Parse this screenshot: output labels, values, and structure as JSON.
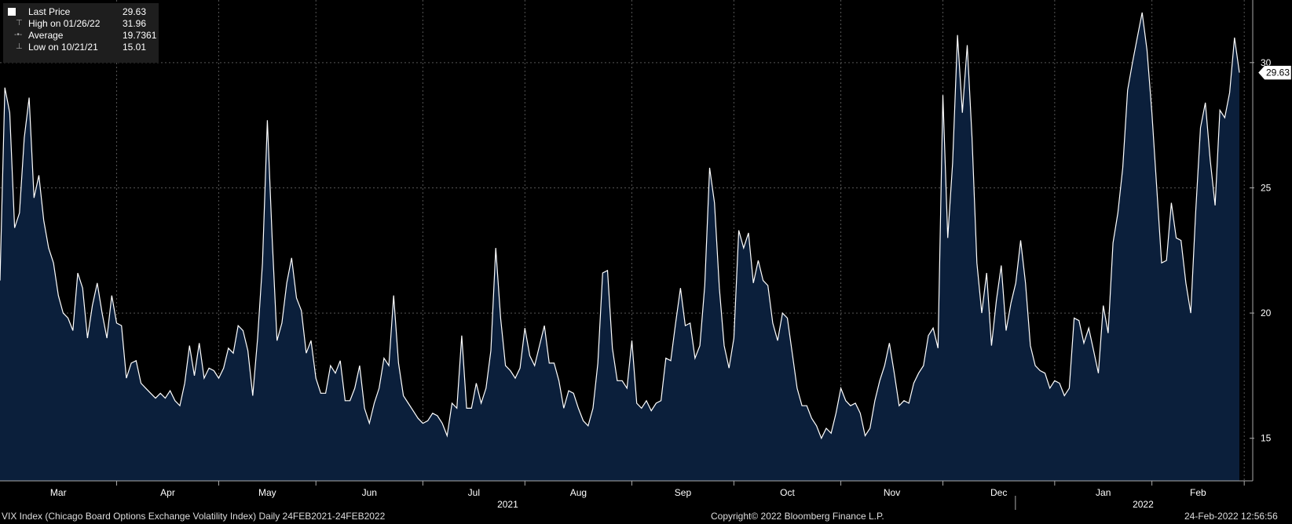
{
  "legend": {
    "last": {
      "label": "Last Price",
      "value": "29.63"
    },
    "high": {
      "label": "High on 01/26/22",
      "value": "31.96"
    },
    "average": {
      "label": "Average",
      "value": "19.7361"
    },
    "low": {
      "label": "Low on 10/21/21",
      "value": "15.01"
    }
  },
  "footer": {
    "left": "VIX Index (Chicago Board Options Exchange Volatility Index)  Daily 24FEB2021-24FEB2022",
    "center": "Copyright© 2022 Bloomberg Finance L.P.",
    "right": "24-Feb-2022 12:56:56"
  },
  "chart_data": {
    "type": "area",
    "ylim": [
      13.3,
      32.5
    ],
    "yticks": [
      15,
      20,
      25,
      30
    ],
    "last_label": "29.63",
    "x_months": [
      "Mar",
      "Apr",
      "May",
      "Jun",
      "Jul",
      "Aug",
      "Sep",
      "Oct",
      "Nov",
      "Dec",
      "Jan",
      "Feb"
    ],
    "x_years": [
      "2021",
      "2022"
    ],
    "grid": true,
    "colors": {
      "line": "#ffffff",
      "fill": "#0b1f3b",
      "grid": "#555555"
    },
    "series": [
      {
        "values": [
          21.3,
          29.0,
          28.0,
          23.4,
          24.0,
          27.0,
          28.6,
          24.6,
          25.5,
          23.7,
          22.6,
          22.0,
          20.7,
          20.0,
          19.8,
          19.3,
          21.6,
          21.0,
          19.0,
          20.3,
          21.2,
          20.0,
          19.0,
          20.7,
          19.6,
          19.5,
          17.4,
          18.0,
          18.1,
          17.2,
          17.0,
          16.8,
          16.6,
          16.8,
          16.6,
          16.9,
          16.5,
          16.3,
          17.2,
          18.7,
          17.5,
          18.8,
          17.4,
          17.8,
          17.7,
          17.4,
          17.8,
          18.6,
          18.4,
          19.5,
          19.3,
          18.5,
          16.7,
          19.0,
          22.0,
          27.7,
          23.0,
          18.9,
          19.6,
          21.2,
          22.2,
          20.6,
          20.1,
          18.4,
          18.9,
          17.4,
          16.8,
          16.8,
          17.9,
          17.6,
          18.1,
          16.5,
          16.5,
          17.0,
          17.9,
          16.2,
          15.6,
          16.4,
          17.0,
          18.2,
          17.9,
          20.7,
          18.0,
          16.7,
          16.4,
          16.1,
          15.8,
          15.6,
          15.7,
          16.0,
          15.9,
          15.6,
          15.1,
          16.4,
          16.2,
          19.1,
          16.2,
          16.2,
          17.2,
          16.4,
          17.0,
          18.5,
          22.6,
          19.8,
          17.9,
          17.7,
          17.4,
          17.8,
          19.4,
          18.3,
          17.9,
          18.7,
          19.5,
          18.0,
          18.0,
          17.3,
          16.2,
          16.9,
          16.8,
          16.2,
          15.7,
          15.5,
          16.2,
          18.0,
          21.6,
          21.7,
          18.6,
          17.3,
          17.3,
          17.0,
          18.9,
          16.4,
          16.2,
          16.5,
          16.1,
          16.4,
          16.5,
          18.2,
          18.1,
          19.6,
          21.0,
          19.5,
          19.6,
          18.2,
          18.7,
          21.1,
          25.8,
          24.4,
          21.0,
          18.7,
          17.8,
          19.0,
          23.3,
          22.6,
          23.2,
          21.2,
          22.1,
          21.3,
          21.1,
          19.6,
          18.9,
          20.0,
          19.8,
          18.4,
          17.0,
          16.3,
          16.3,
          15.8,
          15.5,
          15.0,
          15.4,
          15.2,
          16.0,
          17.0,
          16.5,
          16.3,
          16.4,
          16.0,
          15.1,
          15.4,
          16.5,
          17.3,
          17.9,
          18.8,
          17.6,
          16.3,
          16.5,
          16.4,
          17.2,
          17.6,
          17.9,
          19.1,
          19.4,
          18.6,
          28.7,
          23.0,
          26.0,
          31.1,
          28.0,
          30.7,
          27.0,
          22.0,
          20.0,
          21.6,
          18.7,
          20.5,
          21.9,
          19.3,
          20.4,
          21.2,
          22.9,
          21.2,
          18.7,
          17.9,
          17.7,
          17.6,
          17.0,
          17.3,
          17.2,
          16.7,
          17.0,
          19.8,
          19.7,
          18.8,
          19.4,
          18.5,
          17.6,
          20.3,
          19.2,
          22.8,
          24.0,
          25.8,
          28.9,
          30.0,
          31.0,
          32.0,
          30.5,
          28.0,
          25.0,
          22.0,
          22.1,
          24.4,
          23.0,
          22.9,
          21.2,
          20.0,
          24.0,
          27.4,
          28.4,
          26.1,
          24.3,
          28.1,
          27.8,
          28.8,
          31.0,
          29.6
        ]
      }
    ]
  }
}
